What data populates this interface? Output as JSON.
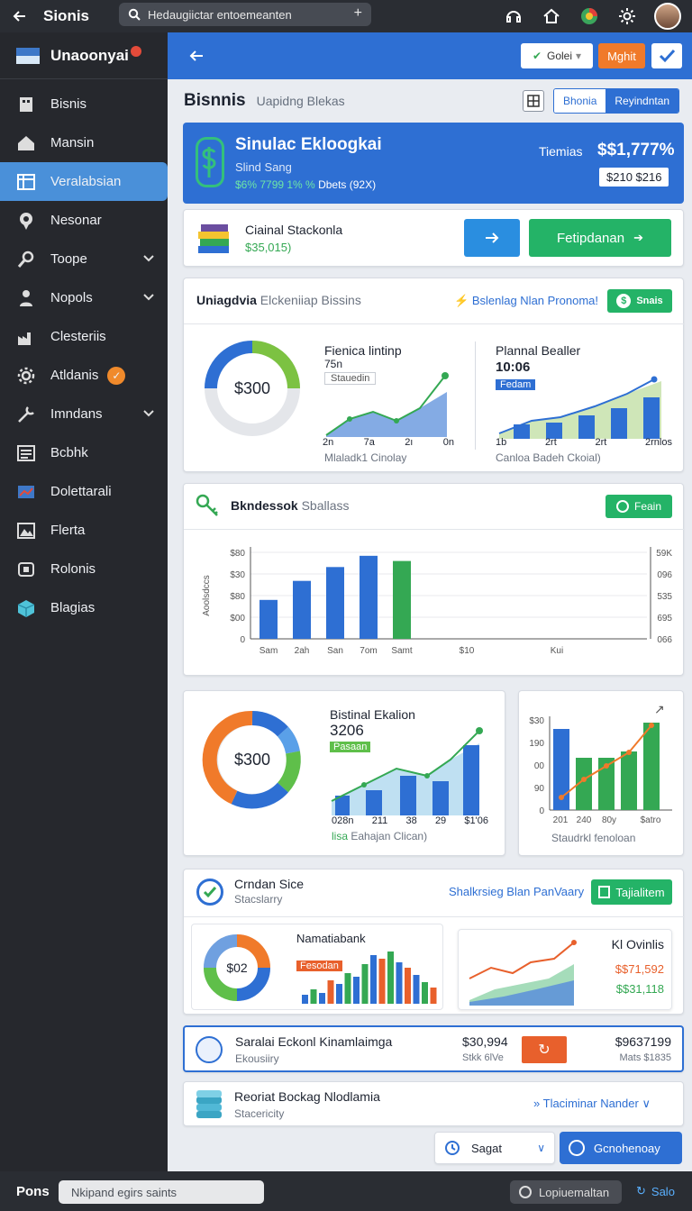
{
  "topbar": {
    "title": "Sionis",
    "search_text": "Hedaugiictar entoemeanten",
    "plus": "+"
  },
  "sidebar": {
    "brand": "Unaoonyai",
    "items": [
      {
        "label": "Bisnis",
        "icon": "building-icon"
      },
      {
        "label": "Mansin",
        "icon": "home-icon"
      },
      {
        "label": "Veralabsian",
        "icon": "table-icon",
        "active": true
      },
      {
        "label": "Nesonar",
        "icon": "pin-icon"
      },
      {
        "label": "Toope",
        "icon": "search-icon",
        "chevron": true
      },
      {
        "label": "Nopols",
        "icon": "person-icon",
        "chevron": true
      },
      {
        "label": "Clesteriis",
        "icon": "factory-icon"
      },
      {
        "label": "Atldanis",
        "icon": "gear-icon",
        "badge": "✓"
      },
      {
        "label": "Imndans",
        "icon": "tools-icon",
        "chevron": true
      },
      {
        "label": "Bcbhk",
        "icon": "list-icon"
      },
      {
        "label": "Dolettarali",
        "icon": "chart-icon"
      },
      {
        "label": "Flerta",
        "icon": "image-icon"
      },
      {
        "label": "Rolonis",
        "icon": "tv-icon"
      },
      {
        "label": "Blagias",
        "icon": "cube-icon"
      }
    ]
  },
  "toolbar": {
    "gold_label": "Golei",
    "might_label": "Mghit"
  },
  "header": {
    "title": "Bisnnis",
    "subtitle": "Uapidng Blekas",
    "seg1": "Bhonia",
    "seg2": "Reyindntan"
  },
  "hero": {
    "title": "Sinulac Ekloogkai",
    "subtitle": "Slind Sang",
    "mini_green": "$6% 7799  1% %",
    "mini_white": " Dbets  (92X)",
    "label": "Tiemias",
    "value": "$$1,777%",
    "pill": "$210  $216"
  },
  "stack_card": {
    "title": "Ciainal Stackonla",
    "value": "$35,015)",
    "cta_label": "Fetipdanan"
  },
  "panel1": {
    "title": "Uniagdvia",
    "subtitle": "Elckeniiap Bissins",
    "link": "Bslenlag Nlan Pronoma!",
    "badge": "Snais",
    "donut_label": "$300",
    "c1_title": "Fienica lintinp",
    "c1_value": "75n",
    "c1_tag": "Stauedin",
    "c1_x": [
      "2n",
      "7a",
      "2ı",
      "0n"
    ],
    "c1_caption": "Mlaladk1 Cinolay",
    "c2_title": "Plannal Bealler",
    "c2_value": "10:06",
    "c2_tag": "Fedam",
    "c2_x": [
      "1b",
      "2rt",
      "2rt",
      "2rnlos"
    ],
    "c2_caption": "Canloa Badeh Ckoial)"
  },
  "panel2": {
    "title": "Bkndessok",
    "subtitle": "Sballass",
    "badge": "Feain",
    "y_left": [
      "$80",
      "$30",
      "$80",
      "$00",
      "0"
    ],
    "y_right": [
      "59K",
      "096",
      "535",
      "695",
      "066"
    ],
    "x_labels": [
      "Sam",
      "2ah",
      "San",
      "7om",
      "Samt",
      "$10",
      "Kui"
    ],
    "y_axis_title": "Aoolsdccs"
  },
  "panel3": {
    "donut_label": "$300",
    "title": "Bistinal Ekalion",
    "value": "3206",
    "tag": "Pasaan",
    "x": [
      "028n",
      "211",
      "38",
      "29",
      "$1'06"
    ],
    "caption_green": "lisa",
    "caption": "Eahajan Clican)"
  },
  "panel4": {
    "y": [
      "$30",
      "190",
      "00",
      "90",
      "0"
    ],
    "x": [
      "201",
      "240",
      "80y",
      "$atro"
    ],
    "caption": "Staudrkl fenoloan"
  },
  "panel5": {
    "title": "Crndan Sice",
    "subtitle": "Stacslarry",
    "link": "Shalkrsieg Blan PanVaary",
    "button": "Tajialitem",
    "donut_label": "$02",
    "c_title": "Namatiabank",
    "c_tag": "Fesodan",
    "r_title": "Kl Ovinlis",
    "r_val1": "$$71,592",
    "r_val2": "$$31,118"
  },
  "row1": {
    "title": "Saralai Eckonl Kinamlaimga",
    "sub": "Ekousiiry",
    "v1": "$30,994",
    "v1_sub": "Stkk  6lVe",
    "v2": "$9637199",
    "v2_sub": "Mats  $1835"
  },
  "row2": {
    "title": "Reoriat Bockag Nlodlamia",
    "sub": "Stacericity",
    "link": "Tlaciminar Nander"
  },
  "bottom_actions": {
    "select": "Sagat",
    "primary": "Gcnohenoay"
  },
  "footer": {
    "label": "Pons",
    "input": "Nkipand egirs saints",
    "pill": "Lopiuemaltan",
    "link": "Salo"
  },
  "colors": {
    "accent": "#2e6fd3",
    "green": "#24b367",
    "orange": "#f07a2a",
    "sidebar": "#26282d"
  },
  "chart_data": [
    {
      "type": "bar",
      "title": "Bkndessok Sballass",
      "categories": [
        "Sam",
        "2ah",
        "San",
        "7om",
        "Samt"
      ],
      "values": [
        45,
        67,
        83,
        96,
        90
      ]
    },
    {
      "type": "bar",
      "categories": [
        "201",
        "240",
        "80y",
        "$atro"
      ],
      "series": [
        {
          "values": [
            90,
            58,
            58,
            65,
            97
          ]
        },
        {
          "values": [
            20,
            40,
            55,
            70,
            100
          ]
        }
      ]
    }
  ]
}
